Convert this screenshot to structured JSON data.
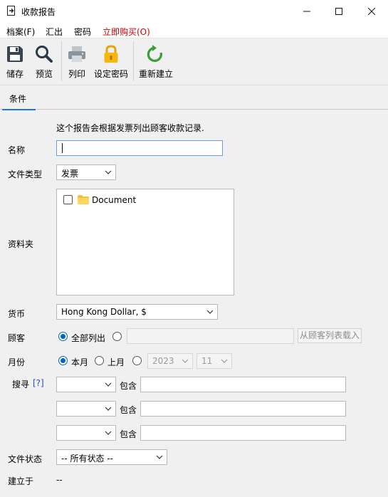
{
  "window": {
    "title": "收款报告"
  },
  "menu": [
    {
      "label": "档案(F)"
    },
    {
      "label": "汇出"
    },
    {
      "label": "密码"
    },
    {
      "label": "立即购买(O)"
    }
  ],
  "toolbar": {
    "save": "储存",
    "preview": "预览",
    "print": "列印",
    "set_password": "设定密码",
    "rebuild": "重新建立"
  },
  "tabs": [
    {
      "label": "条件"
    }
  ],
  "form": {
    "intro": "这个报告会根据发票列出顾客收款记录.",
    "name": {
      "label": "名称",
      "value": ""
    },
    "doc_type": {
      "label": "文件类型",
      "value": "发票"
    },
    "folder": {
      "label": "资料夹",
      "items": [
        {
          "label": "Document",
          "checked": false
        }
      ]
    },
    "currency": {
      "label": "货币",
      "value": "Hong Kong Dollar, $"
    },
    "customer": {
      "label": "顾客",
      "all_label": "全部列出",
      "specific_value": "",
      "load_button": "从顾客列表载入"
    },
    "month": {
      "label": "月份",
      "this_month": "本月",
      "last_month": "上月",
      "year": "2023",
      "month": "11"
    },
    "search": {
      "label": "搜寻",
      "help": "[?]",
      "rows": [
        {
          "field": "",
          "op": "包含",
          "value": ""
        },
        {
          "field": "",
          "op": "包含",
          "value": ""
        },
        {
          "field": "",
          "op": "包含",
          "value": ""
        }
      ]
    },
    "status": {
      "label": "文件状态",
      "value": "-- 所有状态 --"
    },
    "created": {
      "label": "建立于",
      "value": "--"
    }
  },
  "colors": {
    "accent": "#1a73e8",
    "buy_now": "#d10000",
    "radio_selected": "#0067c0"
  }
}
